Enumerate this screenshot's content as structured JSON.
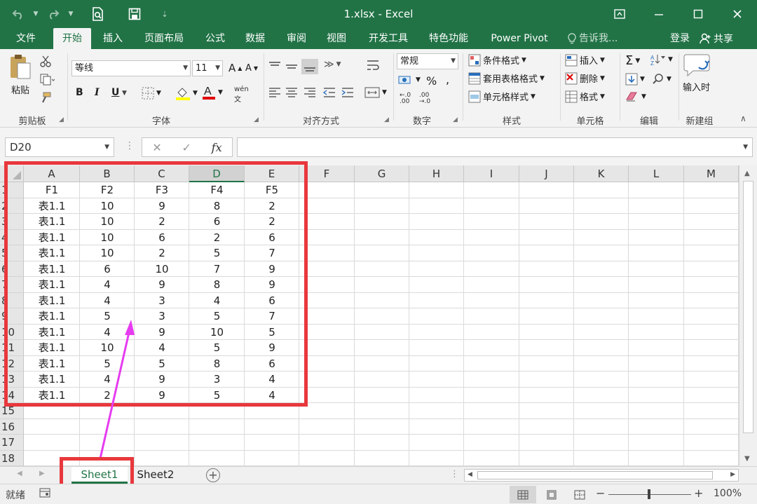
{
  "window": {
    "title": "1.xlsx - Excel"
  },
  "tabs": [
    "文件",
    "开始",
    "插入",
    "页面布局",
    "公式",
    "数据",
    "审阅",
    "视图",
    "开发工具",
    "特色功能",
    "Power Pivot"
  ],
  "tell_me": "告诉我...",
  "login": "登录",
  "share": "共享",
  "ribbon": {
    "clipboard": {
      "paste": "粘贴",
      "label": "剪贴板"
    },
    "font": {
      "name": "等线",
      "size": "11",
      "bold": "B",
      "italic": "I",
      "underline": "U",
      "label": "字体"
    },
    "alignment": {
      "label": "对齐方式"
    },
    "number": {
      "format": "常规",
      "label": "数字"
    },
    "styles": {
      "conditional": "条件格式",
      "table": "套用表格格式",
      "cell": "单元格样式",
      "label": "样式"
    },
    "cells": {
      "insert": "插入",
      "delete": "删除",
      "format": "格式",
      "label": "单元格"
    },
    "editing": {
      "label": "编辑"
    },
    "newgroup": {
      "input_time": "输入时",
      "label": "新建组"
    }
  },
  "namebox": "D20",
  "formula_value": "",
  "columns": [
    "A",
    "B",
    "C",
    "D",
    "E",
    "F",
    "G",
    "H",
    "I",
    "J",
    "K",
    "L",
    "M"
  ],
  "selected_column": "D",
  "rows": [
    "1",
    "2",
    "3",
    "4",
    "5",
    "6",
    "7",
    "8",
    "9",
    "10",
    "11",
    "12",
    "13",
    "14",
    "15",
    "16",
    "17",
    "18"
  ],
  "cells": [
    [
      "F1",
      "F2",
      "F3",
      "F4",
      "F5"
    ],
    [
      "表1.1",
      "10",
      "9",
      "8",
      "2"
    ],
    [
      "表1.1",
      "10",
      "2",
      "6",
      "2"
    ],
    [
      "表1.1",
      "10",
      "6",
      "2",
      "6"
    ],
    [
      "表1.1",
      "10",
      "2",
      "5",
      "7"
    ],
    [
      "表1.1",
      "6",
      "10",
      "7",
      "9"
    ],
    [
      "表1.1",
      "4",
      "9",
      "8",
      "9"
    ],
    [
      "表1.1",
      "4",
      "3",
      "4",
      "6"
    ],
    [
      "表1.1",
      "5",
      "3",
      "5",
      "7"
    ],
    [
      "表1.1",
      "4",
      "9",
      "10",
      "5"
    ],
    [
      "表1.1",
      "10",
      "4",
      "5",
      "9"
    ],
    [
      "表1.1",
      "5",
      "5",
      "8",
      "6"
    ],
    [
      "表1.1",
      "4",
      "9",
      "3",
      "4"
    ],
    [
      "表1.1",
      "2",
      "9",
      "5",
      "4"
    ]
  ],
  "sheets": [
    "Sheet1",
    "Sheet2"
  ],
  "active_sheet": "Sheet1",
  "status": {
    "ready": "就绪",
    "zoom": "100%"
  },
  "colors": {
    "brand": "#217346",
    "annotation": "#e8383d",
    "arrow": "#e63cf0"
  }
}
